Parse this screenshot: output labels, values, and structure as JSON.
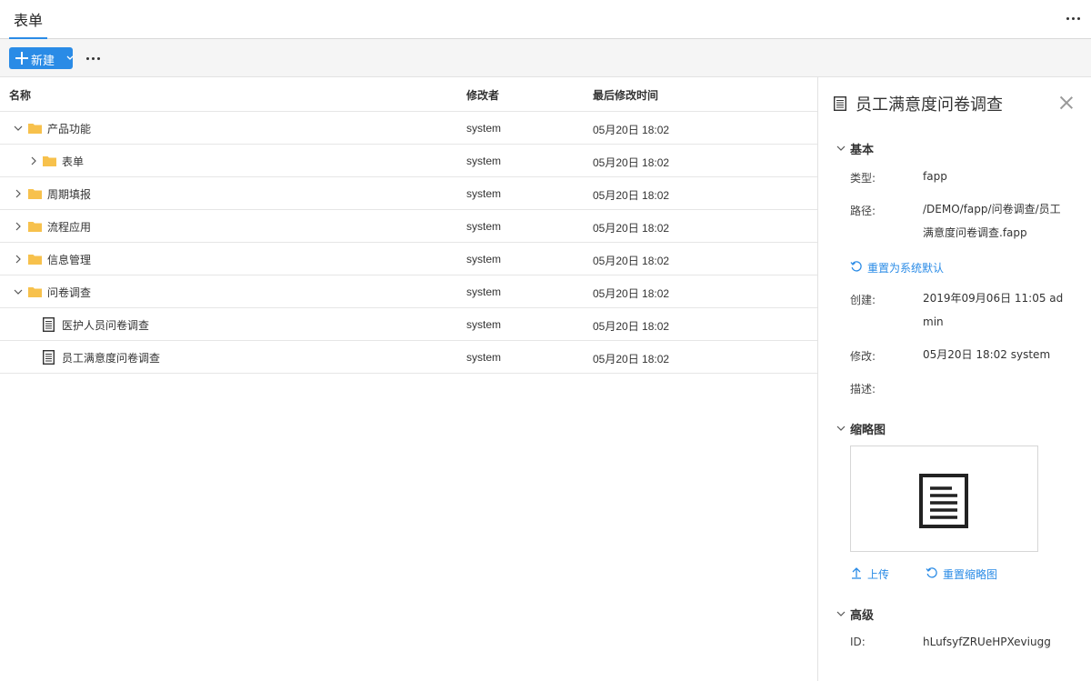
{
  "tab": {
    "title": "表单"
  },
  "toolbar": {
    "new_label": "新建"
  },
  "list": {
    "headers": {
      "name": "名称",
      "modifier": "修改者",
      "modified_time": "最后修改时间"
    },
    "rows": [
      {
        "name": "产品功能",
        "modifier": "system",
        "time": "05月20日 18:02"
      },
      {
        "name": "表单",
        "modifier": "system",
        "time": "05月20日 18:02"
      },
      {
        "name": "周期填报",
        "modifier": "system",
        "time": "05月20日 18:02"
      },
      {
        "name": "流程应用",
        "modifier": "system",
        "time": "05月20日 18:02"
      },
      {
        "name": "信息管理",
        "modifier": "system",
        "time": "05月20日 18:02"
      },
      {
        "name": "问卷调查",
        "modifier": "system",
        "time": "05月20日 18:02"
      },
      {
        "name": "医护人员问卷调查",
        "modifier": "system",
        "time": "05月20日 18:02"
      },
      {
        "name": "员工满意度问卷调查",
        "modifier": "system",
        "time": "05月20日 18:02"
      }
    ]
  },
  "panel": {
    "title": "员工满意度问卷调查",
    "basic": {
      "label": "基本",
      "type_label": "类型:",
      "type_value": "fapp",
      "path_label": "路径:",
      "path_value": "/DEMO/fapp/问卷调查/员工满意度问卷调查.fapp",
      "reset_label": "重置为系统默认",
      "created_label": "创建:",
      "created_value": "2019年09月06日 11:05 admin",
      "modified_label": "修改:",
      "modified_value": "05月20日 18:02 system",
      "desc_label": "描述:"
    },
    "thumbnail": {
      "label": "缩略图",
      "upload_label": "上传",
      "reset_label": "重置缩略图"
    },
    "advanced": {
      "label": "高级",
      "id_label": "ID:",
      "id_value": "hLufsyfZRUeHPXeviugg"
    }
  },
  "colors": {
    "accent": "#2a8be6",
    "folder": "#f7c14c"
  },
  "icons": {
    "folder": "folder-icon",
    "document": "document-icon",
    "expand": "chevron-down-icon",
    "collapse": "chevron-right-icon",
    "close": "close-icon",
    "reset": "undo-icon",
    "upload": "upload-icon",
    "more": "more-icon"
  }
}
